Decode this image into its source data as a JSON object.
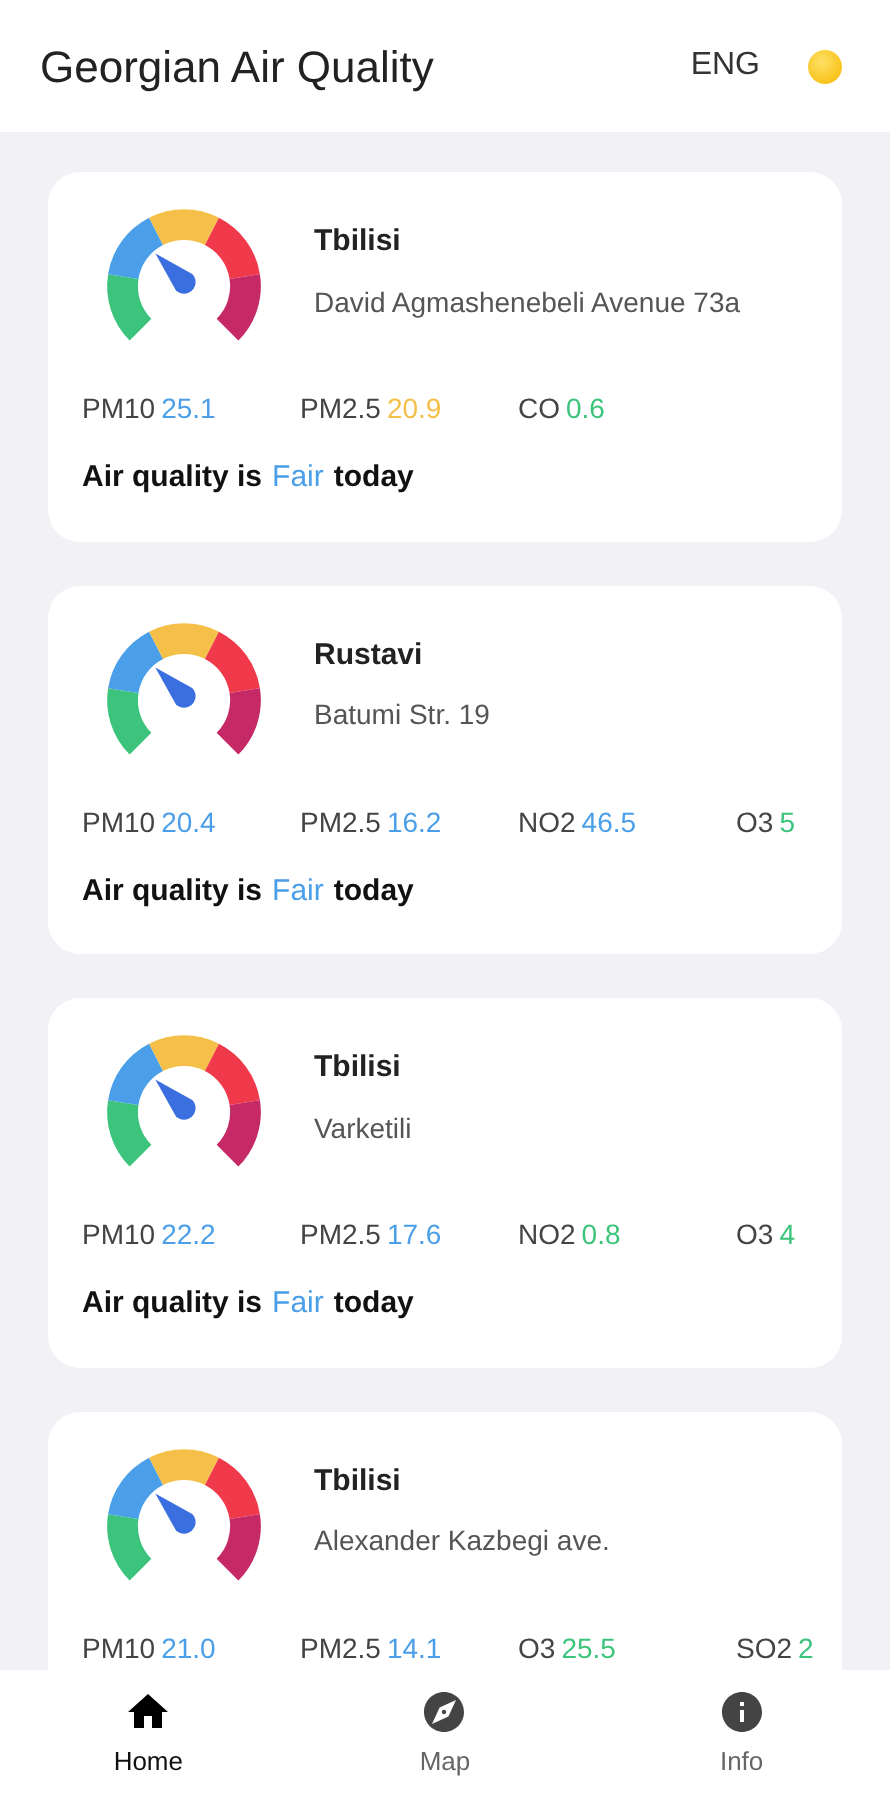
{
  "header": {
    "title": "Georgian Air Quality",
    "language": "ENG"
  },
  "stations": [
    {
      "city": "Tbilisi",
      "address": "David Agmashenebeli Avenue 73a",
      "pollutants": [
        {
          "name": "PM10",
          "value": "25.1",
          "color": "#4a9fe8"
        },
        {
          "name": "PM2.5",
          "value": "20.9",
          "color": "#f5c04a"
        },
        {
          "name": "CO",
          "value": "0.6",
          "color": "#3cc47c"
        }
      ],
      "quality": {
        "prefix": "Air quality is",
        "word": "Fair",
        "color": "#4a9fe8",
        "suffix": "today"
      }
    },
    {
      "city": "Rustavi",
      "address": "Batumi Str. 19",
      "pollutants": [
        {
          "name": "PM10",
          "value": "20.4",
          "color": "#4a9fe8"
        },
        {
          "name": "PM2.5",
          "value": "16.2",
          "color": "#4a9fe8"
        },
        {
          "name": "NO2",
          "value": "46.5",
          "color": "#4a9fe8"
        },
        {
          "name": "O3",
          "value": "5",
          "color": "#3cc47c"
        }
      ],
      "quality": {
        "prefix": "Air quality is",
        "word": "Fair",
        "color": "#4a9fe8",
        "suffix": "today"
      }
    },
    {
      "city": "Tbilisi",
      "address": "Varketili",
      "pollutants": [
        {
          "name": "PM10",
          "value": "22.2",
          "color": "#4a9fe8"
        },
        {
          "name": "PM2.5",
          "value": "17.6",
          "color": "#4a9fe8"
        },
        {
          "name": "NO2",
          "value": "0.8",
          "color": "#3cc47c"
        },
        {
          "name": "O3",
          "value": "4",
          "color": "#3cc47c"
        }
      ],
      "quality": {
        "prefix": "Air quality is",
        "word": "Fair",
        "color": "#4a9fe8",
        "suffix": "today"
      }
    },
    {
      "city": "Tbilisi",
      "address": "Alexander Kazbegi ave.",
      "pollutants": [
        {
          "name": "PM10",
          "value": "21.0",
          "color": "#4a9fe8"
        },
        {
          "name": "PM2.5",
          "value": "14.1",
          "color": "#4a9fe8"
        },
        {
          "name": "O3",
          "value": "25.5",
          "color": "#3cc47c"
        },
        {
          "name": "SO2",
          "value": "2",
          "color": "#3cc47c"
        }
      ]
    }
  ],
  "nav": [
    {
      "kind": "home",
      "label": "Home",
      "selected": true
    },
    {
      "kind": "map",
      "label": "Map",
      "selected": false
    },
    {
      "kind": "info",
      "label": "Info",
      "selected": false
    }
  ]
}
